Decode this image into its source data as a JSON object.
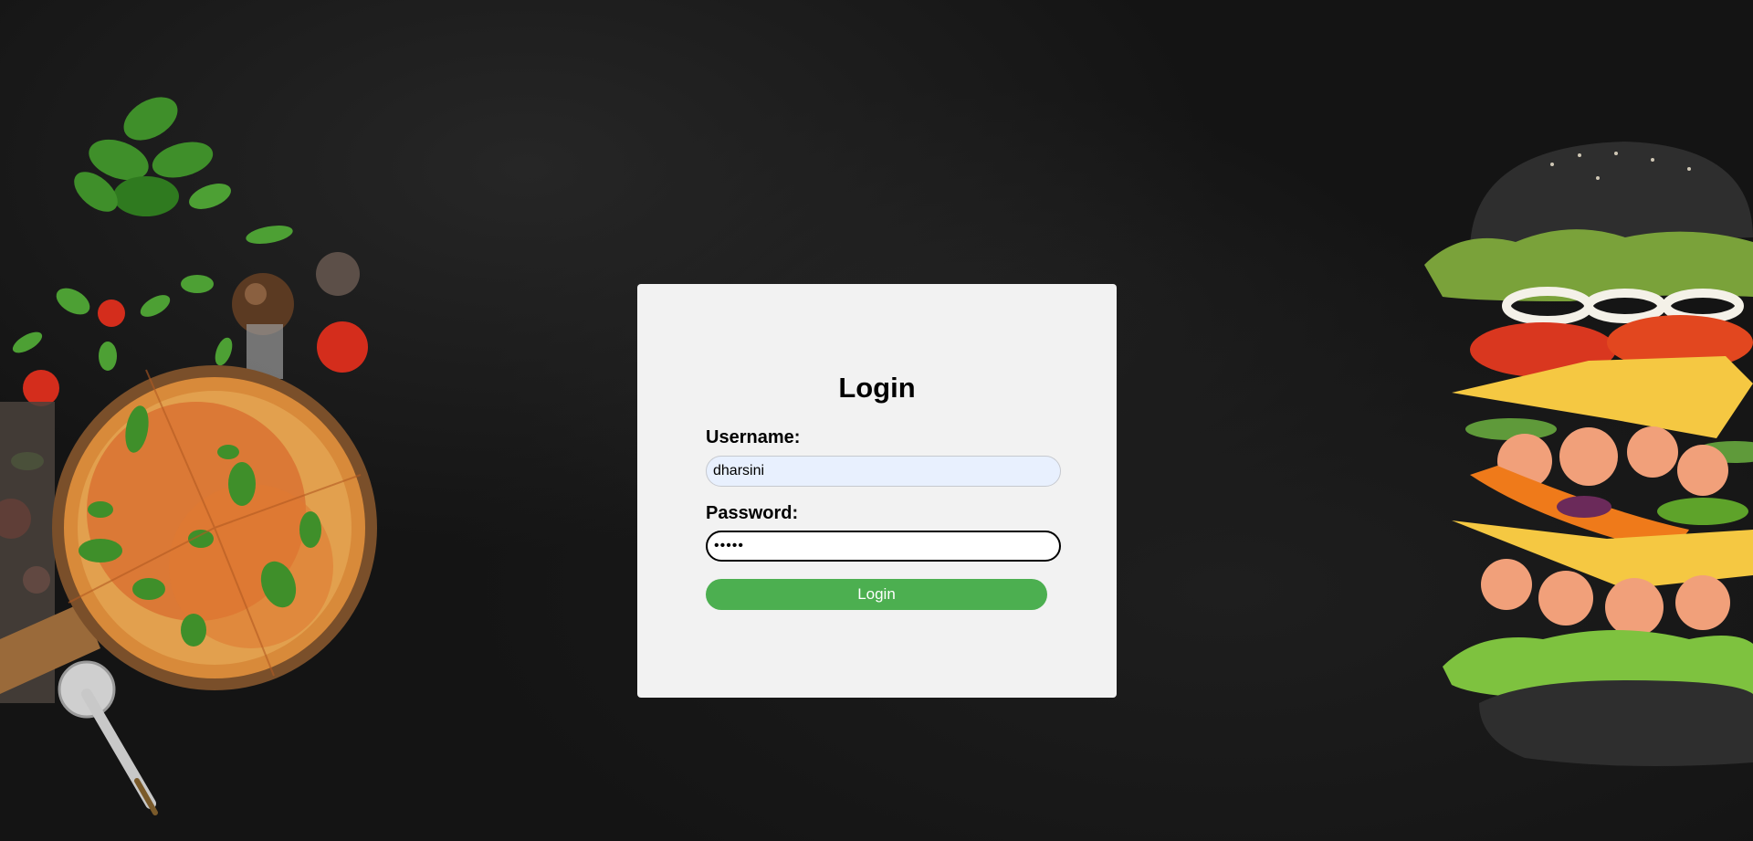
{
  "login": {
    "title": "Login",
    "username_label": "Username:",
    "username_value": "dharsini",
    "password_label": "Password:",
    "password_value": "•••••",
    "button_label": "Login"
  },
  "colors": {
    "background": "#141414",
    "card": "#f2f2f2",
    "button": "#4caf50",
    "username_field": "#e8f0fe"
  },
  "decorations": [
    "pizza-illustration",
    "burger-illustration"
  ]
}
